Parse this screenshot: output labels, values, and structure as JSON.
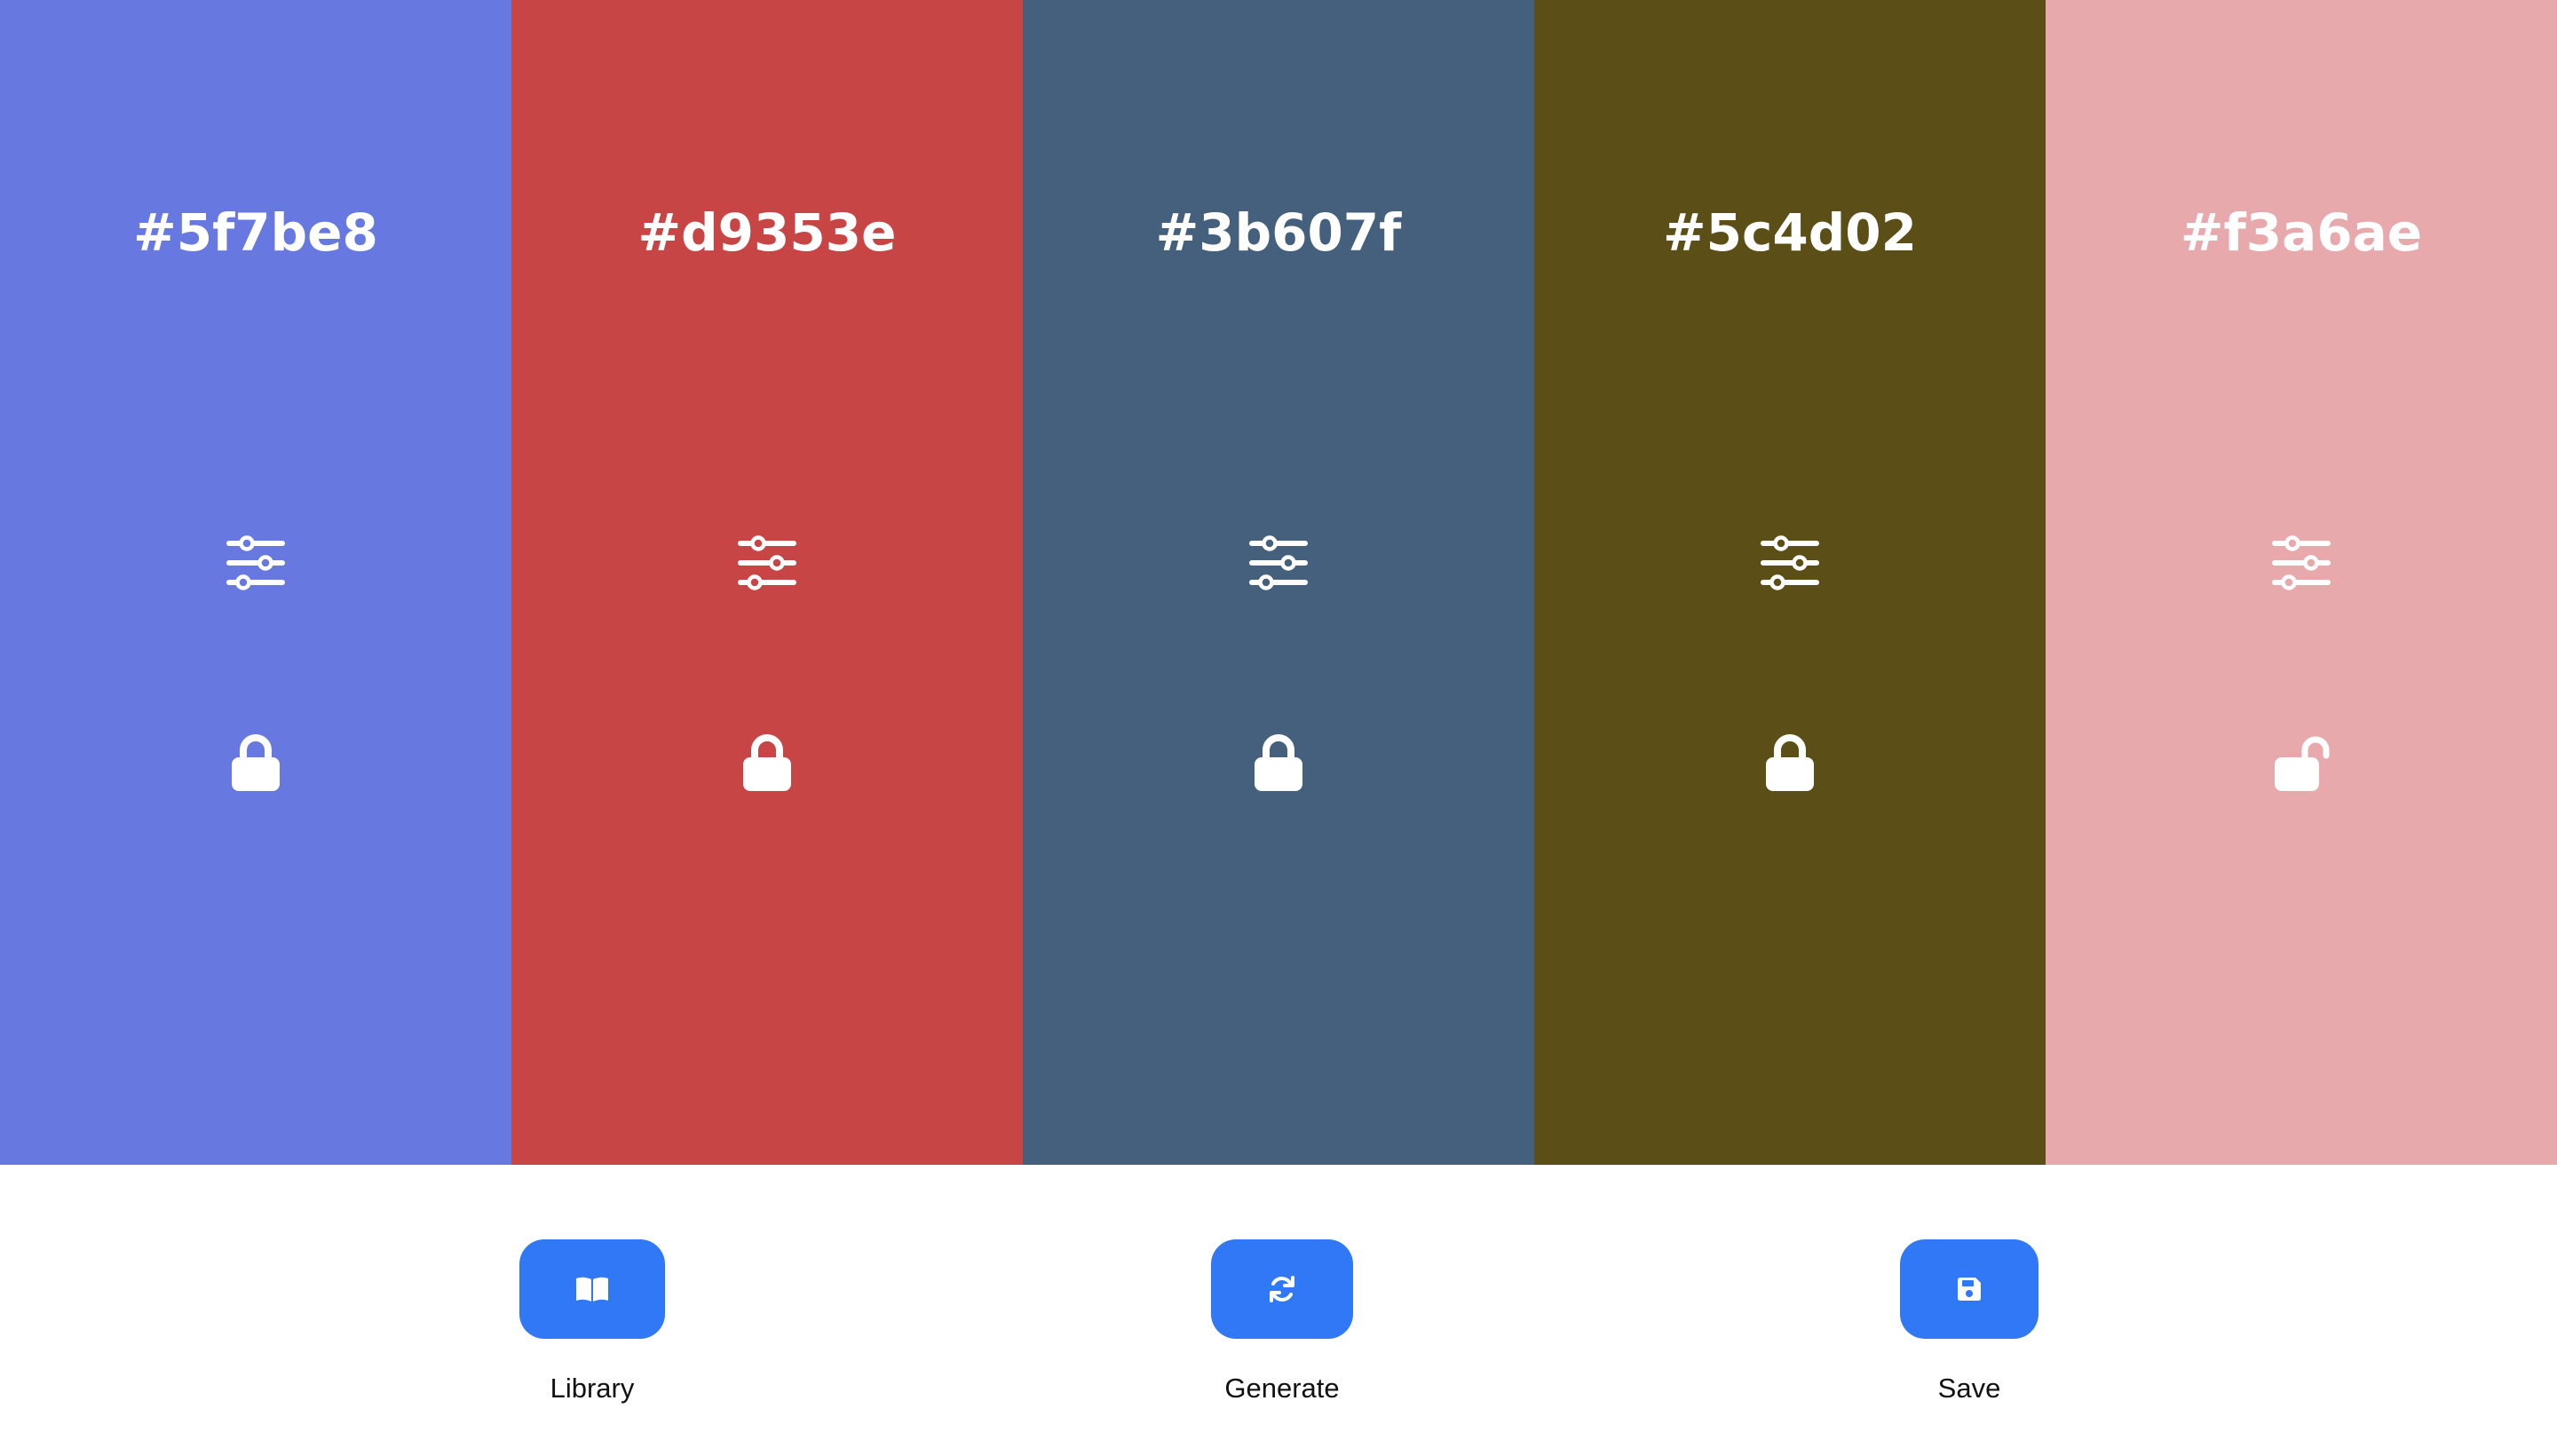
{
  "palette": {
    "swatches": [
      {
        "hex": "#5f7be8",
        "color": "#6779e0",
        "locked": true
      },
      {
        "hex": "#d9353e",
        "color": "#c84545",
        "locked": true
      },
      {
        "hex": "#3b607f",
        "color": "#45607c",
        "locked": true
      },
      {
        "hex": "#5c4d02",
        "color": "#5b4e16",
        "locked": true
      },
      {
        "hex": "#f3a6ae",
        "color": "#e8a9ad",
        "locked": false
      }
    ],
    "adjust_icon": "sliders-icon",
    "lock_icon": "lock-icon",
    "unlock_icon": "unlock-icon"
  },
  "toolbar": {
    "accent": "#3178f6",
    "library": {
      "label": "Library",
      "icon": "book-open-icon"
    },
    "generate": {
      "label": "Generate",
      "icon": "refresh-icon"
    },
    "save": {
      "label": "Save",
      "icon": "floppy-disk-icon"
    }
  }
}
